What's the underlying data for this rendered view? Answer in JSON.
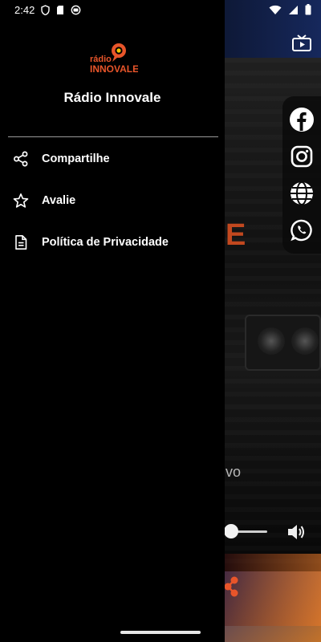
{
  "status_bar": {
    "time": "2:42",
    "icons": [
      "shield-icon",
      "sd-card-icon",
      "record-icon",
      "wifi-icon",
      "signal-icon",
      "battery-icon"
    ]
  },
  "drawer": {
    "logo": {
      "line1": "rádio",
      "line2": "INNOVALE"
    },
    "title": "Rádio Innovale",
    "menu": [
      {
        "label": "Compartilhe",
        "icon": "share-icon"
      },
      {
        "label": "Avalie",
        "icon": "star-icon"
      },
      {
        "label": "Política de Privacidade",
        "icon": "document-icon"
      }
    ]
  },
  "background_app": {
    "partial_logo_text": "E",
    "partial_caption": "vo",
    "social_icons": [
      "facebook-icon",
      "instagram-icon",
      "globe-icon",
      "whatsapp-icon"
    ],
    "volume_level": 0.05
  },
  "colors": {
    "drawer_bg": "#000000",
    "accent_orange": "#e8552a",
    "text": "#ffffff",
    "divider": "#9a9a9a"
  }
}
